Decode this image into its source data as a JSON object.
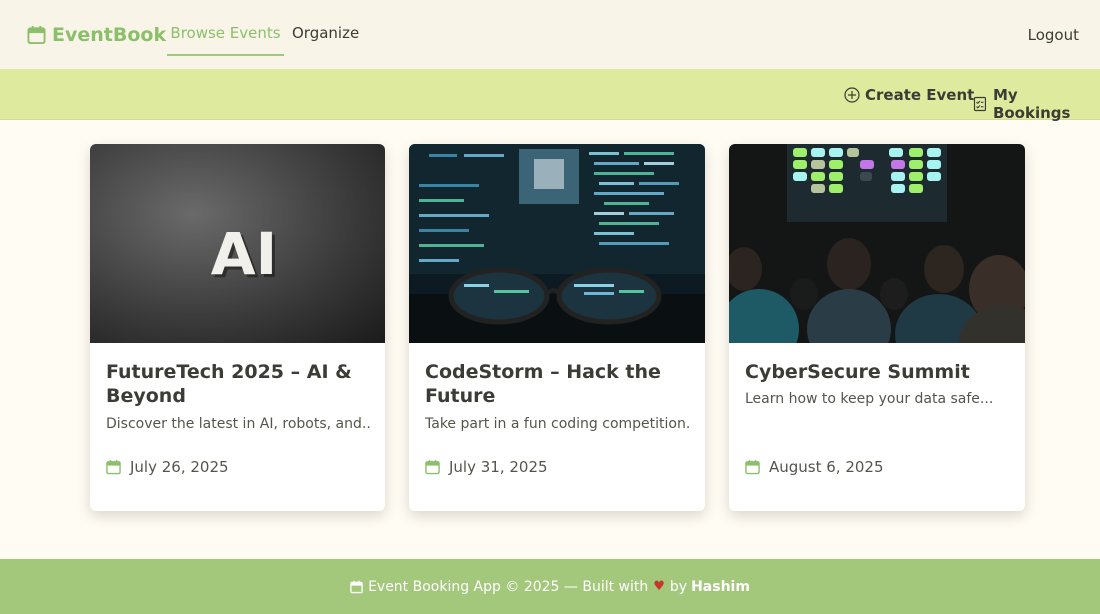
{
  "nav": {
    "brand": "EventBook",
    "links": [
      "Browse Events",
      "Organize"
    ],
    "logout": "Logout"
  },
  "subbar": {
    "create_event": "Create Event",
    "my_bookings": "My Bookings"
  },
  "events": [
    {
      "title": "FutureTech 2025 – AI & Beyond",
      "description": "Discover the latest in AI, robots, and...",
      "date": "July 26, 2025",
      "image_text": "AI"
    },
    {
      "title": "CodeStorm – Hack the Future",
      "description": "Take part in a fun coding competition...",
      "date": "July 31, 2025"
    },
    {
      "title": "CyberSecure Summit",
      "description": "Learn how to keep your data safe...",
      "date": "August 6, 2025"
    }
  ],
  "footer": {
    "text": "Event Booking App © 2025 — Built with",
    "heart": "♥",
    "by": "by",
    "author": "Hashim"
  },
  "colors": {
    "accent": "#8cbf6a",
    "subbar": "#deeb9f",
    "footer": "#a4c87b",
    "heart": "#c0392b"
  }
}
